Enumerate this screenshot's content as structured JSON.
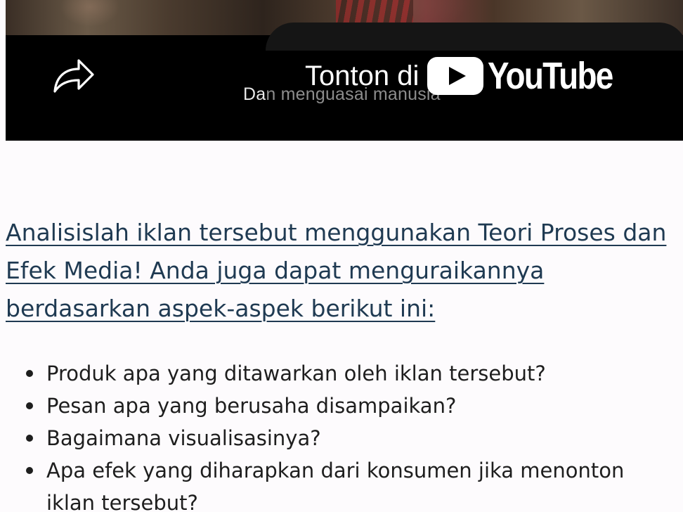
{
  "video": {
    "subtitle_highlight": "Da",
    "subtitle_rest": "n menguasai manusia",
    "watch_label": "Tonton di",
    "youtube_logo_text": "YouTube",
    "share_icon": "share-arrow-icon",
    "play_icon": "youtube-play-icon",
    "colors": {
      "overlay": "#000000",
      "youtube_red_replaced_by_white": "#ffffff"
    }
  },
  "article": {
    "prompt": "Analisislah iklan tersebut menggunakan Teori Proses dan Efek Media! Anda juga dapat menguraikannya berdasarkan aspek-aspek berikut ini:",
    "questions": [
      "Produk apa yang ditawarkan oleh iklan tersebut?",
      "Pesan apa yang berusaha disampaikan?",
      "Bagaimana visualisasinya?",
      "Apa efek yang diharapkan dari konsumen jika menonton iklan tersebut?"
    ],
    "colors": {
      "link_text": "#1f3a52",
      "body_text": "#1e1e1e",
      "background": "#fdfbfd"
    }
  }
}
